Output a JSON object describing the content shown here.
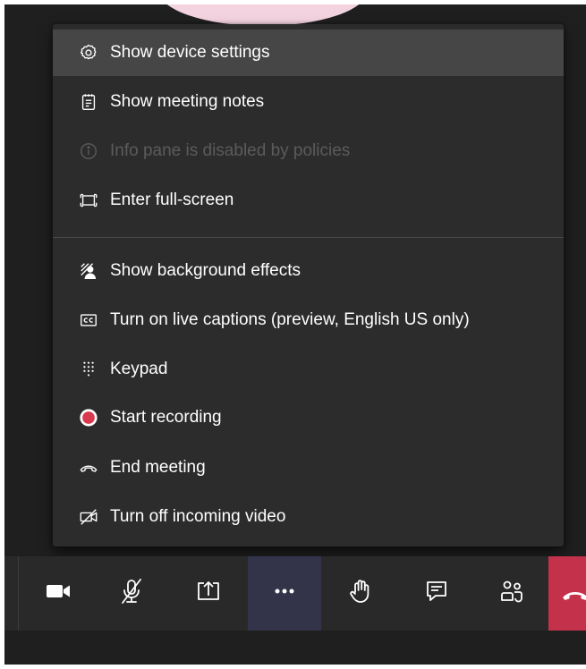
{
  "menu": {
    "items": [
      {
        "label": "Show device settings",
        "icon": "gear-icon"
      },
      {
        "label": "Show meeting notes",
        "icon": "notes-icon"
      },
      {
        "label": "Info pane is disabled by policies",
        "icon": "info-icon",
        "disabled": true
      },
      {
        "label": "Enter full-screen",
        "icon": "fullscreen-icon"
      },
      {
        "label": "Show background effects",
        "icon": "background-effects-icon"
      },
      {
        "label": "Turn on live captions (preview, English US only)",
        "icon": "captions-icon"
      },
      {
        "label": "Keypad",
        "icon": "keypad-icon"
      },
      {
        "label": "Start recording",
        "icon": "record-icon"
      },
      {
        "label": "End meeting",
        "icon": "end-meeting-icon"
      },
      {
        "label": "Turn off incoming video",
        "icon": "video-off-icon"
      }
    ]
  },
  "toolbar": {
    "buttons": [
      {
        "name": "camera",
        "icon": "camera-icon"
      },
      {
        "name": "mute",
        "icon": "mic-off-icon"
      },
      {
        "name": "share",
        "icon": "share-screen-icon"
      },
      {
        "name": "more",
        "icon": "more-options-icon",
        "active": true
      },
      {
        "name": "raise-hand",
        "icon": "raise-hand-icon"
      },
      {
        "name": "chat",
        "icon": "chat-icon"
      },
      {
        "name": "participants",
        "icon": "participants-icon"
      },
      {
        "name": "hang-up",
        "icon": "hang-up-icon"
      }
    ]
  },
  "colors": {
    "background": "#1f1f1f",
    "menu_bg": "#2d2c2c",
    "menu_highlight": "#474646",
    "toolbar_bg": "#292929",
    "active_button": "#33344a",
    "hangup": "#c4314b",
    "record_red": "#d93a4f",
    "avatar_pink": "#f3d3df"
  }
}
